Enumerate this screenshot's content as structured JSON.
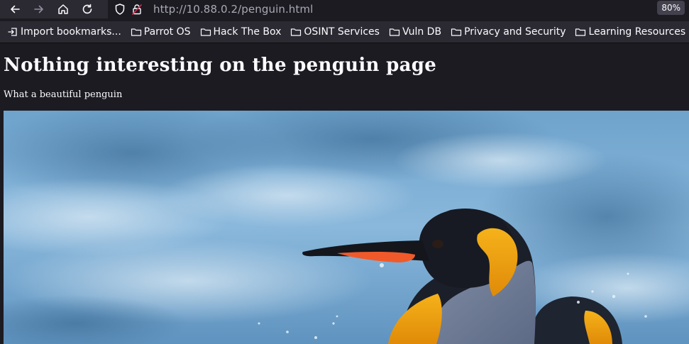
{
  "browser": {
    "url_host": "http://10.88.0.2",
    "url_path": "/penguin.html",
    "zoom": "80%"
  },
  "bookmarks": [
    {
      "label": "Import bookmarks...",
      "icon": "import-icon"
    },
    {
      "label": "Parrot OS",
      "icon": "folder-icon"
    },
    {
      "label": "Hack The Box",
      "icon": "folder-icon"
    },
    {
      "label": "OSINT Services",
      "icon": "folder-icon"
    },
    {
      "label": "Vuln DB",
      "icon": "folder-icon"
    },
    {
      "label": "Privacy and Security",
      "icon": "folder-icon"
    },
    {
      "label": "Learning Resources",
      "icon": "folder-icon"
    }
  ],
  "page": {
    "heading": "Nothing interesting on the penguin page",
    "subtitle": "What a beautiful penguin"
  },
  "colors": {
    "toolbar": "#2b2a33",
    "page_bg": "#1c1b22",
    "sky": "#7fb0d6",
    "beak_stripe": "#f05a2a",
    "ear_patch": "#f29a10"
  }
}
